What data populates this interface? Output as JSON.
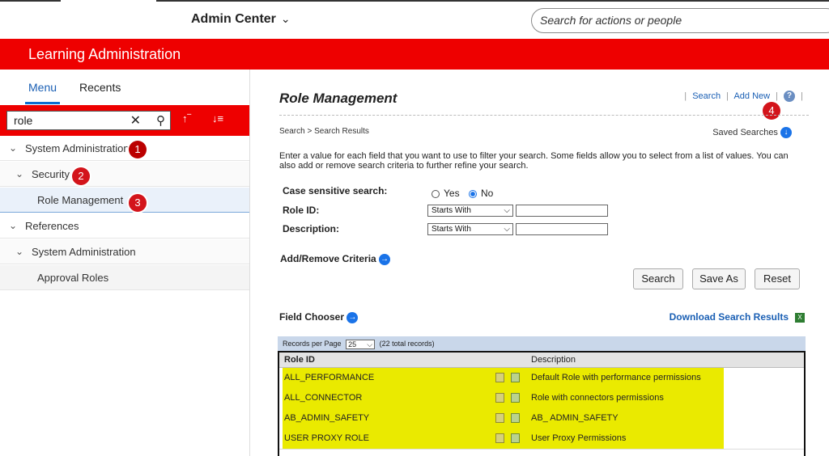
{
  "header": {
    "admin_center": "Admin Center",
    "search_placeholder": "Search for actions or people"
  },
  "banner": {
    "title": "Learning Administration"
  },
  "sidebar": {
    "tabs": [
      {
        "label": "Menu"
      },
      {
        "label": "Recents"
      }
    ],
    "search_value": "role",
    "tree": [
      {
        "label": "System Administration"
      },
      {
        "label": "Security"
      },
      {
        "label": "Role Management"
      },
      {
        "label": "References"
      },
      {
        "label": "System Administration"
      },
      {
        "label": "Approval Roles"
      }
    ]
  },
  "badges": [
    "1",
    "2",
    "3",
    "4"
  ],
  "main": {
    "title": "Role Management",
    "links": {
      "search": "Search",
      "add_new": "Add New"
    },
    "breadcrumb": "Search > Search Results",
    "saved_searches": "Saved Searches",
    "instructions": "Enter a value for each field that you want to use to filter your search. Some fields allow you to select from a list of values. You can also add or remove search criteria to further refine your search.",
    "case_label": "Case sensitive search:",
    "yes_label": "Yes",
    "no_label": "No",
    "role_id_label": "Role ID:",
    "description_label": "Description:",
    "starts_with": "Starts With",
    "add_remove": "Add/Remove Criteria",
    "buttons": {
      "search": "Search",
      "save_as": "Save As",
      "reset": "Reset"
    },
    "field_chooser": "Field Chooser",
    "download": "Download Search Results",
    "records_per_page": "Records per Page",
    "rpp_value": "25",
    "total_records": "(22 total records)",
    "columns": {
      "role_id": "Role ID",
      "description": "Description"
    },
    "rows": [
      {
        "role_id": "ALL_PERFORMANCE",
        "description": "Default Role with performance permissions"
      },
      {
        "role_id": "ALL_CONNECTOR",
        "description": "Role with connectors permissions"
      },
      {
        "role_id": "AB_ADMIN_SAFETY",
        "description": "AB_ ADMIN_SAFETY"
      },
      {
        "role_id": "USER PROXY ROLE",
        "description": "User Proxy Permissions"
      }
    ]
  }
}
